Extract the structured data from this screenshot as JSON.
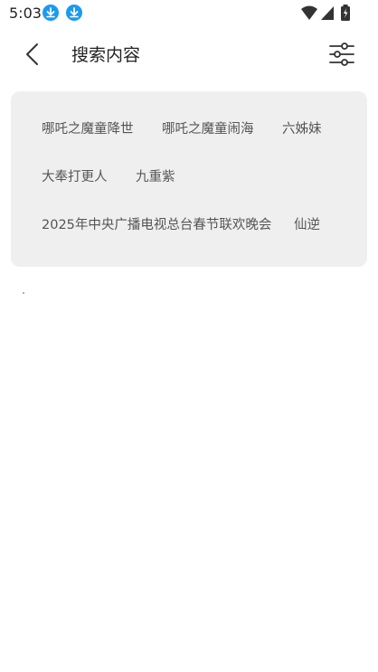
{
  "status_bar": {
    "time": "5:03",
    "icons": [
      "download-icon",
      "download-icon",
      "wifi-icon",
      "signal-icon",
      "battery-icon"
    ],
    "accent_color": "#1a9bf0"
  },
  "header": {
    "title": "搜索内容",
    "back_icon": "chevron-left-icon",
    "filter_icon": "sliders-icon"
  },
  "keywords": [
    "哪吒之魔童降世",
    "哪吒之魔童闹海",
    "六姊妹",
    "大奉打更人",
    "九重紫",
    "2025年中央广播电视总台春节联欢晚会",
    "仙逆"
  ],
  "colors": {
    "panel_background": "#efefef",
    "keyword_text": "#555555"
  }
}
